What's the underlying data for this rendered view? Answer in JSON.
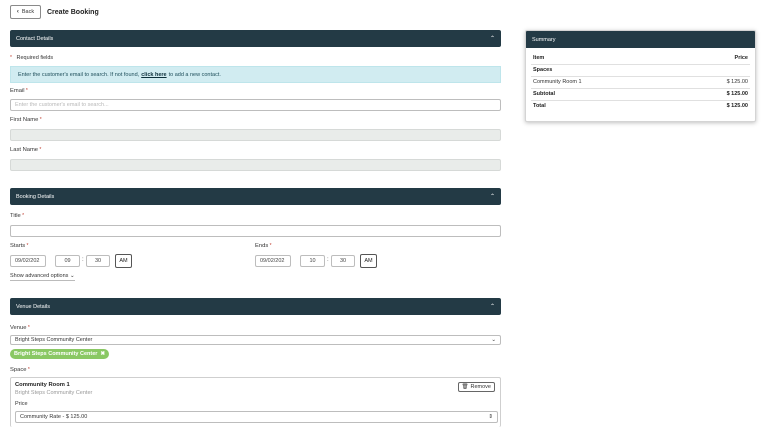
{
  "header": {
    "back_label": "Back",
    "title": "Create Booking"
  },
  "contact": {
    "section_title": "Contact Details",
    "required_note": "Required fields",
    "info_prefix": "Enter the customer's email to search. If not found,",
    "info_link": "click here",
    "info_suffix": "to add a new contact.",
    "email_label": "Email",
    "email_placeholder": "Enter the customer's email to search...",
    "first_name_label": "First Name",
    "last_name_label": "Last Name"
  },
  "booking": {
    "section_title": "Booking Details",
    "title_label": "Title",
    "starts_label": "Starts",
    "start_date": "09/02/202",
    "start_hour": "09",
    "start_minute": "30",
    "start_ampm": "AM",
    "ends_label": "Ends",
    "end_date": "09/02/202",
    "end_hour": "10",
    "end_minute": "30",
    "end_ampm": "AM",
    "advanced_label": "Show advanced options"
  },
  "venue": {
    "section_title": "Venue Details",
    "venue_label": "Venue",
    "venue_selected": "Bright Steps Community Center",
    "chip_label": "Bright Steps Community Center",
    "space_label": "Space",
    "space_name": "Community Room 1",
    "space_venue": "Bright Steps Community Center",
    "remove_label": "Remove",
    "price_label": "Price",
    "rate_selected": "Community Rate - $ 125.00"
  },
  "summary": {
    "title": "Summary",
    "col_item": "Item",
    "col_price": "Price",
    "group": "Spaces",
    "rows": [
      {
        "item": "Community Room 1",
        "price": "$ 125.00"
      }
    ],
    "subtotal_label": "Subtotal",
    "subtotal_value": "$ 125.00",
    "total_label": "Total",
    "total_value": "$ 125.00"
  },
  "colors": {
    "header_bg": "#233a45",
    "info_bg": "#d1ecf1",
    "chip_bg": "#8ac864",
    "required": "#c0392b"
  }
}
